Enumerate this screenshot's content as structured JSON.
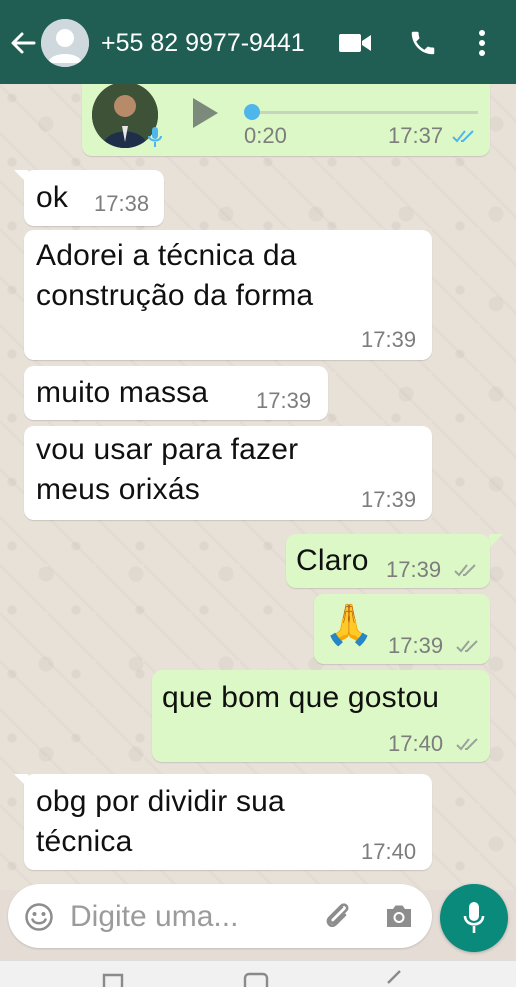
{
  "header": {
    "contact_name": "+55 82 9977-9441",
    "icons": [
      "back-arrow-icon",
      "avatar",
      "video-call-icon",
      "phone-icon",
      "more-vert-icon"
    ]
  },
  "messages": [
    {
      "direction": "outgoing",
      "kind": "voice",
      "duration": "0:20",
      "time": "17:37",
      "status": "read"
    },
    {
      "direction": "incoming",
      "kind": "text",
      "lines": [
        "ok"
      ],
      "time": "17:38"
    },
    {
      "direction": "incoming",
      "kind": "text",
      "lines": [
        "Adorei a técnica da",
        "construção da forma"
      ],
      "time": "17:39"
    },
    {
      "direction": "incoming",
      "kind": "text",
      "lines": [
        "muito massa"
      ],
      "time": "17:39"
    },
    {
      "direction": "incoming",
      "kind": "text",
      "lines": [
        "vou usar para fazer",
        "meus orixás"
      ],
      "time": "17:39"
    },
    {
      "direction": "outgoing",
      "kind": "text",
      "lines": [
        "Claro"
      ],
      "time": "17:39",
      "status": "delivered"
    },
    {
      "direction": "outgoing",
      "kind": "emoji",
      "lines": [
        "🙏"
      ],
      "time": "17:39",
      "status": "delivered"
    },
    {
      "direction": "outgoing",
      "kind": "text",
      "lines": [
        "que bom que gostou"
      ],
      "time": "17:40",
      "status": "delivered"
    },
    {
      "direction": "incoming",
      "kind": "text",
      "lines": [
        "obg por dividir sua",
        "técnica"
      ],
      "time": "17:40"
    }
  ],
  "composer": {
    "placeholder": "Digite uma...",
    "icons": [
      "emoji-icon",
      "attach-icon",
      "camera-icon",
      "mic-icon"
    ]
  },
  "colors": {
    "header": "#205e54",
    "incoming_bubble": "#ffffff",
    "outgoing_bubble": "#dcf8c6",
    "read_ticks": "#4fb6ec",
    "delivered_ticks": "#9aa39a",
    "mic_button": "#0a8a7a"
  }
}
